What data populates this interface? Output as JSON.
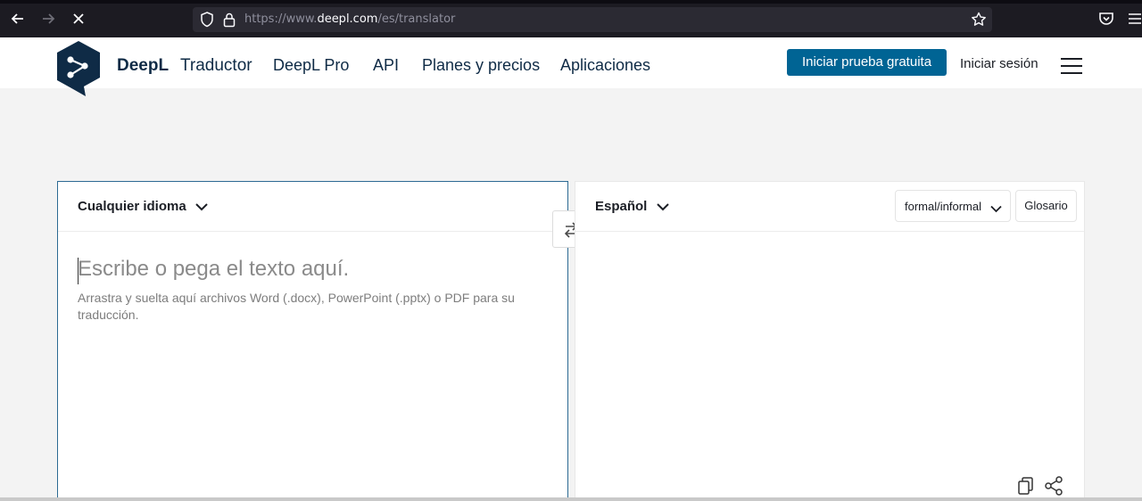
{
  "browser": {
    "url_prefix": "https://www.",
    "url_host": "deepl.com",
    "url_path": "/es/translator"
  },
  "header": {
    "brand": "DeepL",
    "brand_sub": "Traductor",
    "nav": [
      "DeepL Pro",
      "API",
      "Planes y precios",
      "Aplicaciones"
    ],
    "cta": "Iniciar prueba gratuita",
    "login": "Iniciar sesión"
  },
  "source": {
    "language": "Cualquier idioma",
    "placeholder": "Escribe o pega el texto aquí.",
    "hint": "Arrastra y suelta aquí archivos Word (.docx), PowerPoint (.pptx) o PDF para su traducción."
  },
  "target": {
    "language": "Español",
    "formality": "formal/informal",
    "glossary": "Glosario"
  },
  "colors": {
    "accent": "#006494",
    "brand_navy": "#0f2b46"
  }
}
